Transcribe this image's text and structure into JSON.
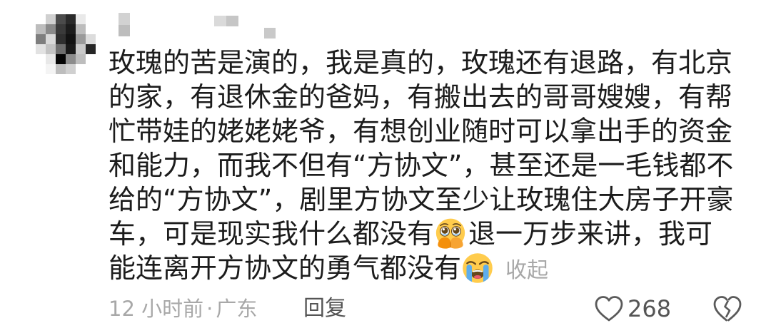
{
  "comment": {
    "lines": [
      "玫瑰的苦是演的，我是真的，玫瑰还有退路，有北京",
      "的家，有退休金的爸妈，有搬出去的哥哥嫂嫂，有帮",
      "忙带娃的姥姥姥爷，有想创业随时可以拿出手的资金",
      "和能力，而我不但有“方协文”，甚至还是一毛钱都不",
      "给的“方协文”，剧里方协文至少让玫瑰住大房子开豪"
    ],
    "line6": {
      "before": "车，可是现实我什么都没有",
      "emoji": "face-holding-back-tears-icon",
      "after": "退一万步来讲，我可"
    },
    "line7": {
      "before": "能连离开方协文的勇气都没有",
      "emoji": "loudly-crying-face-icon"
    },
    "collapse_label": "收起"
  },
  "meta": {
    "time": "12 小时前",
    "separator": "·",
    "location": "广东",
    "reply_label": "回复"
  },
  "actions": {
    "like_icon": "heart-outline-icon",
    "like_count": "268",
    "dislike_icon": "broken-heart-icon"
  },
  "colors": {
    "text": "#1c1c1c",
    "muted": "#a8a8a8",
    "secondary": "#555555",
    "icon": "#5a5a5a"
  }
}
